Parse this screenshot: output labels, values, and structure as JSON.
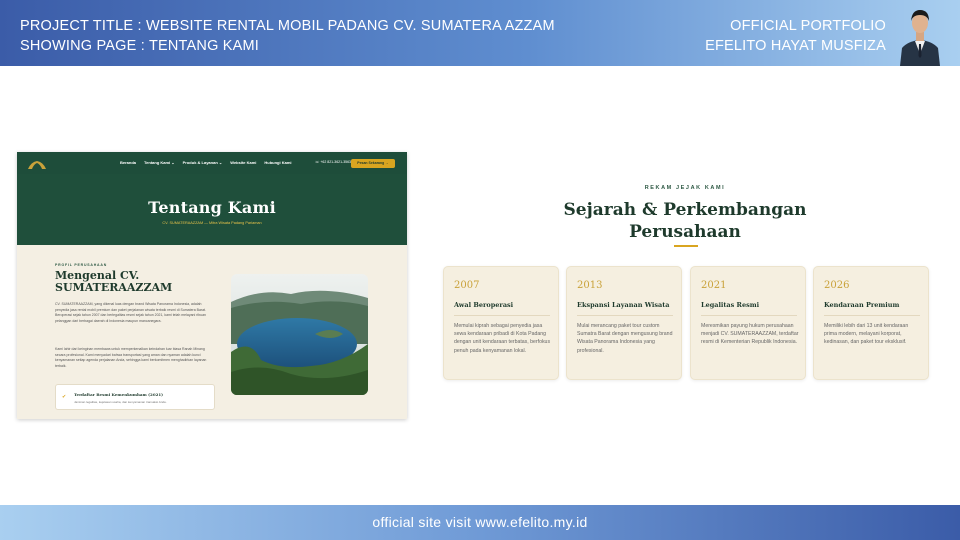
{
  "header": {
    "project_line": "PROJECT TITLE : WEBSITE RENTAL MOBIL PADANG CV. SUMATERA AZZAM",
    "page_line": "SHOWING PAGE : TENTANG KAMI",
    "portfolio_line": "OFFICIAL PORTFOLIO",
    "author_line": "EFELITO HAYAT MUSFIZA"
  },
  "footer": {
    "text": "official site visit www.efelito.my.id"
  },
  "mockup": {
    "nav": {
      "links": [
        "Beranda",
        "Tentang Kami ⌄",
        "Produk & Layanan ⌄",
        "Website Kami",
        "Hubungi Kami"
      ],
      "phone": "☏ +62 821-3621-3563",
      "cta": "Pesan Sekarang →"
    },
    "hero": {
      "title": "Tentang Kami",
      "subtitle": "CV. SUMATERAAZZAM — Mitra Wisata Padang Pariaman"
    },
    "about": {
      "eyebrow": "PROFIL PERUSAHAAN",
      "title": "Mengenal CV. SUMATERAAZZAM",
      "p1": "CV. SUMATERAAZZAM, yang dikenal luas dengan brand Wisata Panorama Indonesia, adalah penyedia jasa rental mobil premium dan paket perjalanan wisata terbaik resmi di Sumatera Barat. Beroperasi sejak tahun 2007 dan berlegalitas resmi sejak tahun 2021, kami telah melayani ribuan pelanggan dari berbagai daerah di Indonesia maupun mancanegara.",
      "p2": "Kami lahir dari keinginan membawa untuk memperkenalkan keindahan luar biasa Ranah Minang secara profesional. Kami menyadari bahwa transportasi yang aman dan nyaman adalah kunci kenyamanan setiap agenda perjalanan Anda, sehingga kami berkomitmen menghadirkan layanan terbaik.",
      "box_title": "Terdaftar Resmi Kemenkumham (2021)",
      "box_sub": "Jaminan legalitas, kejelasan usaha, dan kenyamanan transaksi Anda.",
      "box_icon": "✔"
    }
  },
  "history": {
    "eyebrow": "REKAM JEJAK KAMI",
    "title": "Sejarah & Perkembangan Perusahaan",
    "cards": [
      {
        "year": "2007",
        "title": "Awal Beroperasi",
        "desc": "Memulai kiprah sebagai penyedia jasa sewa kendaraan pribadi di Kota Padang dengan unit kendaraan terbatas, berfokus penuh pada kenyamanan lokal."
      },
      {
        "year": "2013",
        "title": "Ekspansi Layanan Wisata",
        "desc": "Mulai merancang paket tour custom Sumatra Barat dengan mengusung brand Wisata Panorama Indonesia yang profesional."
      },
      {
        "year": "2021",
        "title": "Legalitas Resmi",
        "desc": "Meresmikan payung hukum perusahaan menjadi CV. SUMATERAAZZAM, terdaftar resmi di Kementerian Republik Indonesia."
      },
      {
        "year": "2026",
        "title": "Kendaraan Premium",
        "desc": "Memiliki lebih dari 13 unit kendaraan prima modern, melayani korporat, kedinasan, dan paket tour eksklusif."
      }
    ]
  }
}
